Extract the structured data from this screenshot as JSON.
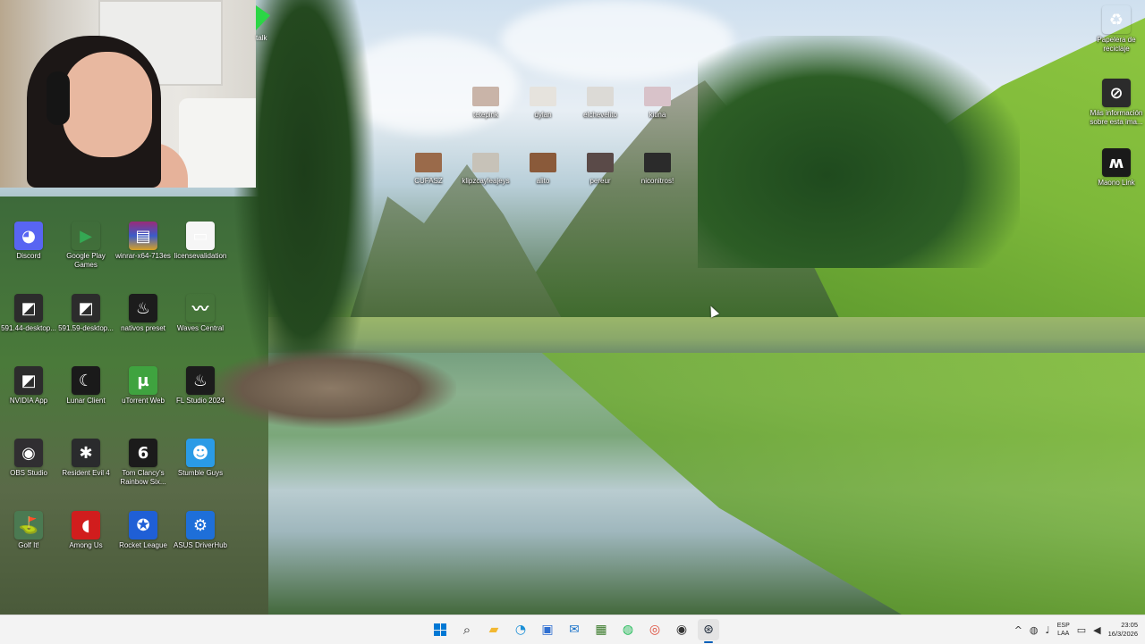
{
  "desktop": {
    "icons_left": [
      {
        "label": "Discord",
        "icon": "discord-icon",
        "glyph": "◕"
      },
      {
        "label": "Google Play Games",
        "icon": "google-play-games-icon",
        "glyph": "▶"
      },
      {
        "label": "winrar-x64-713es",
        "icon": "winrar-icon",
        "glyph": "▤"
      },
      {
        "label": "licensevalidation",
        "icon": "document-icon",
        "glyph": "▭"
      },
      {
        "label": "591.44-desktop...",
        "icon": "nvidia-installer-icon",
        "glyph": "◩"
      },
      {
        "label": "591.59-desktop...",
        "icon": "nvidia-installer-icon",
        "glyph": "◩"
      },
      {
        "label": "nativos preset",
        "icon": "fl-studio-icon",
        "glyph": "♨"
      },
      {
        "label": "Waves Central",
        "icon": "waves-icon",
        "glyph": "〰"
      },
      {
        "label": "NVIDIA App",
        "icon": "nvidia-icon",
        "glyph": "◩"
      },
      {
        "label": "Lunar Client",
        "icon": "lunar-client-icon",
        "glyph": "☾"
      },
      {
        "label": "uTorrent Web",
        "icon": "utorrent-icon",
        "glyph": "µ"
      },
      {
        "label": "FL Studio 2024",
        "icon": "fl-studio-icon",
        "glyph": "♨"
      },
      {
        "label": "OBS Studio",
        "icon": "obs-icon",
        "glyph": "◉"
      },
      {
        "label": "Resident Evil 4",
        "icon": "resident-evil-icon",
        "glyph": "✱"
      },
      {
        "label": "Tom Clancy's Rainbow Six...",
        "icon": "rainbow-six-icon",
        "glyph": "6"
      },
      {
        "label": "Stumble Guys",
        "icon": "stumble-guys-icon",
        "glyph": "☻"
      },
      {
        "label": "Golf It!",
        "icon": "golf-it-icon",
        "glyph": "⛳"
      },
      {
        "label": "Among Us",
        "icon": "among-us-icon",
        "glyph": "◖"
      },
      {
        "label": "Rocket League",
        "icon": "rocket-league-icon",
        "glyph": "✪"
      },
      {
        "label": "ASUS DriverHub",
        "icon": "asus-driverhub-icon",
        "glyph": "⚙"
      }
    ],
    "icons_top": [
      {
        "label": "tetepink",
        "color": "#c9b4a8"
      },
      {
        "label": "dylan",
        "color": "#e6e3dd"
      },
      {
        "label": "elchevelito",
        "color": "#dcdad6"
      },
      {
        "label": "kitina",
        "color": "#d8c2c9"
      },
      {
        "label": "CUFASZ",
        "color": "#9a6a4a"
      },
      {
        "label": "klipzcayleajeys",
        "color": "#c7c2b8"
      },
      {
        "label": "alito",
        "color": "#8a5a3a"
      },
      {
        "label": "pereur",
        "color": "#5a4a48"
      },
      {
        "label": "niconitros!",
        "color": "#2b2b2b"
      }
    ],
    "icons_right": [
      {
        "label": "Papelera de reciclaje",
        "icon": "recycle-bin-icon",
        "glyph": "♻"
      },
      {
        "label": "Más información sobre esta ima...",
        "icon": "info-icon",
        "glyph": "⊘"
      },
      {
        "label": "Maono Link",
        "icon": "maono-link-icon",
        "glyph": "ʍ"
      }
    ],
    "tl_label": "talk"
  },
  "taskbar": {
    "apps": [
      {
        "name": "start",
        "icon": "windows-start-icon",
        "glyph": ""
      },
      {
        "name": "search",
        "icon": "search-icon",
        "glyph": "⌕"
      },
      {
        "name": "file-explorer",
        "icon": "folder-icon",
        "glyph": "▰"
      },
      {
        "name": "edge",
        "icon": "edge-icon",
        "glyph": "◔"
      },
      {
        "name": "store",
        "icon": "store-icon",
        "glyph": "▣"
      },
      {
        "name": "outlook",
        "icon": "outlook-icon",
        "glyph": "✉"
      },
      {
        "name": "game-app",
        "icon": "game-icon",
        "glyph": "▦"
      },
      {
        "name": "spotify",
        "icon": "spotify-icon",
        "glyph": "◍"
      },
      {
        "name": "chrome",
        "icon": "chrome-icon",
        "glyph": "◎"
      },
      {
        "name": "obs",
        "icon": "obs-icon",
        "glyph": "◉"
      },
      {
        "name": "steam",
        "icon": "steam-icon",
        "glyph": "⊛"
      }
    ],
    "active_app": "steam",
    "tray": {
      "chevron": "^",
      "lang_line1": "ESP",
      "lang_line2": "LAA",
      "time": "23:05",
      "date": "16/3/2026"
    }
  }
}
